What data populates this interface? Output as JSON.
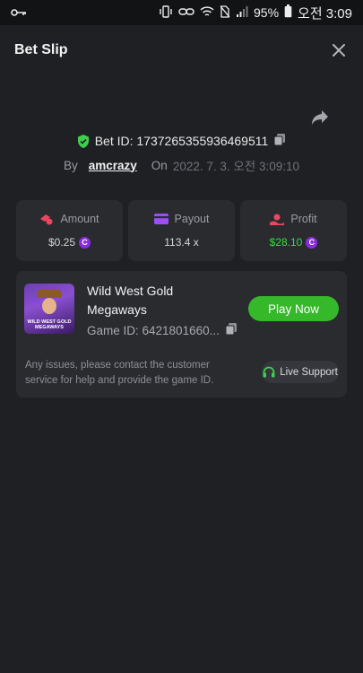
{
  "status_bar": {
    "battery": "95%",
    "time": "오전 3:09"
  },
  "header": {
    "title": "Bet Slip"
  },
  "bet": {
    "id_label": "Bet ID: 1737265355936469511",
    "by_label": "By",
    "user": "amcrazy",
    "on_label": "On",
    "date": "2022. 7. 3. 오전 3:09:10"
  },
  "stats": {
    "amount": {
      "label": "Amount",
      "value": "$0.25"
    },
    "payout": {
      "label": "Payout",
      "value": "113.4 x"
    },
    "profit": {
      "label": "Profit",
      "value": "$28.10"
    }
  },
  "coin_symbol": "C",
  "game": {
    "name": "Wild West Gold Megaways",
    "thumb_text": "WILD WEST GOLD MEGAWAYS",
    "id_label": "Game ID: 6421801660...",
    "play_label": "Play Now",
    "issue_text": "Any issues, please contact the customer service for help and provide the game ID.",
    "support_label": "Live Support"
  },
  "colors": {
    "accent_green": "#36b82b",
    "profit_green": "#41d94d",
    "coin_purple": "#8a2be2",
    "amount_red": "#e9465f",
    "payout_purple": "#9b4dff"
  },
  "icons": [
    "key-icon",
    "vibrate-icon",
    "wifi-icon",
    "signal-icon",
    "battery-icon",
    "close-icon",
    "share-icon",
    "shield-check-icon",
    "copy-icon",
    "coins-icon",
    "card-icon",
    "profit-icon",
    "headphones-icon"
  ]
}
